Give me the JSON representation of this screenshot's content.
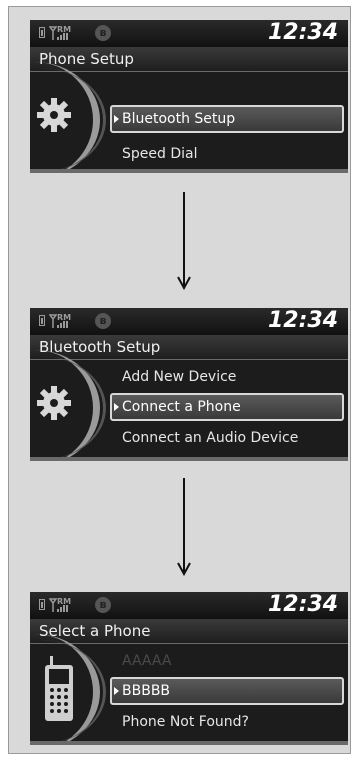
{
  "screens": [
    {
      "time": "12:34",
      "title": "Phone Setup",
      "icon": "gear-icon",
      "items": [
        {
          "label": "Bluetooth Setup",
          "selected": true,
          "dim": false
        },
        {
          "label": "Speed Dial",
          "selected": false,
          "dim": false
        }
      ]
    },
    {
      "time": "12:34",
      "title": "Bluetooth Setup",
      "icon": "gear-icon",
      "items": [
        {
          "label": "Add New Device",
          "selected": false,
          "dim": false
        },
        {
          "label": "Connect a Phone",
          "selected": true,
          "dim": false
        },
        {
          "label": "Connect an Audio Device",
          "selected": false,
          "dim": false
        }
      ]
    },
    {
      "time": "12:34",
      "title": "Select a Phone",
      "icon": "phone-icon",
      "items": [
        {
          "label": "AAAAA",
          "selected": false,
          "dim": true
        },
        {
          "label": "BBBBB",
          "selected": true,
          "dim": false
        },
        {
          "label": "Phone Not Found?",
          "selected": false,
          "dim": false
        }
      ]
    }
  ],
  "status_icons": {
    "signal_label": "RM",
    "bluetooth_glyph": "ʙ"
  }
}
